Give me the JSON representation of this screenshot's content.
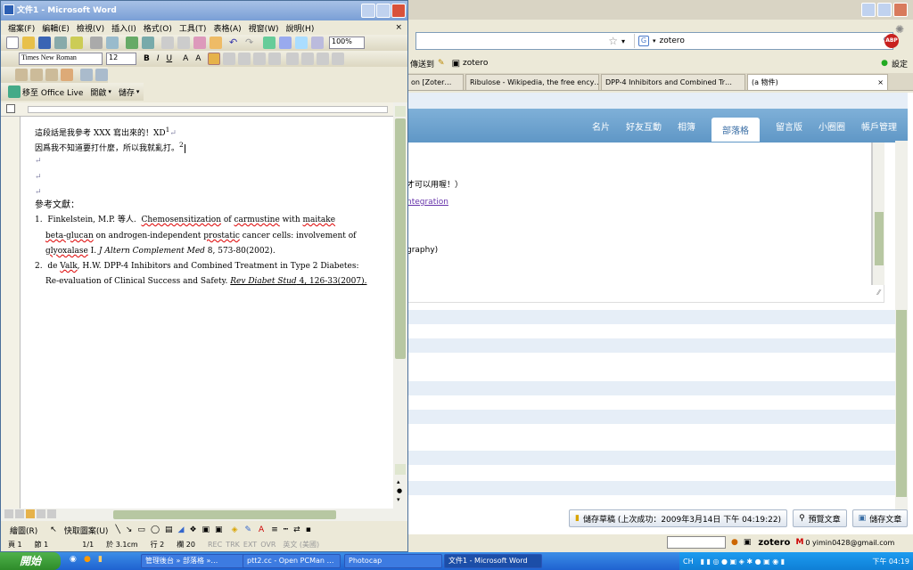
{
  "word": {
    "title": "文件1 - Microsoft Word",
    "menu": [
      "檔案(F)",
      "編輯(E)",
      "檢視(V)",
      "插入(I)",
      "格式(O)",
      "工具(T)",
      "表格(A)",
      "視窗(W)",
      "說明(H)"
    ],
    "zoom": "100%",
    "font": "Times New Roman",
    "size": "12",
    "office_live": "移至 Office Live",
    "open": "開啟",
    "save": "儲存",
    "doc": {
      "line1": "這段話是我參考 XXX 寫出來的！XD",
      "line1_sup": "1",
      "line2": "因爲我不知道要打什麼，所以我就亂打。",
      "line2_sup": "2",
      "refs_heading": "參考文獻：",
      "ref1_num": "1.",
      "ref1_a": "Finkelstein, M.P.  等人.",
      "ref1_b": "Chemosensitization",
      "ref1_c": " of ",
      "ref1_d": "carmustine",
      "ref1_e": " with ",
      "ref1_f": "maitake",
      "ref1_g": "beta-glucan",
      "ref1_h": " on androgen-independent ",
      "ref1_i": "prostatic",
      "ref1_j": " cancer cells: involvement of",
      "ref1_k": "glyoxalase",
      "ref1_l": " I. ",
      "ref1_m": "J Altern Complement Med",
      "ref1_n": " 8, 573-80(2002).",
      "ref2_num": "2.",
      "ref2_a": "de ",
      "ref2_b": "Valk",
      "ref2_c": ", H.W. DPP-4 Inhibitors and Combined Treatment in Type 2 Diabetes:",
      "ref2_d": "Re-evaluation of Clinical Success and Safety. ",
      "ref2_e": "Rev Diabet Stud",
      "ref2_f": " 4, 126-33(2007)."
    },
    "draw_label": "繪圖(R)",
    "autoshape": "快取圖案(U)",
    "status": [
      "頁 1",
      "節 1",
      "1/1",
      "於 3.1cm",
      "行 2",
      "欄 20",
      "REC",
      "TRK",
      "EXT",
      "OVR",
      "英文 (美國)"
    ]
  },
  "firefox": {
    "url_search": "zotero",
    "bm_send": "傳送到",
    "bm_zotero": "zotero",
    "settings": "設定",
    "tabs": [
      "on [Zoter…",
      "Ribulose - Wikipedia, the free ency…",
      "DPP-4 Inhibitors and Combined Tr…",
      "(a 物件)"
    ],
    "nav": [
      "名片",
      "好友互動",
      "相簿",
      "部落格",
      "留言版",
      "小圈圈",
      "帳戶管理"
    ],
    "editor_text1": "才可以用喔！）",
    "editor_link": "ntegration",
    "editor_text2": "graphy)",
    "draft": "儲存草稿 (上次成功：2009年3月14日 下午 04:19:22)",
    "preview": "預覽文章",
    "publish": "儲存文章",
    "status_zotero": "zotero",
    "status_mail": "0 yimin0428@gmail.com"
  },
  "taskbar": {
    "start": "開始",
    "tasks": [
      "管理後台 » 部落格 »…",
      "ptt2.cc - Open PCMan …",
      "Photocap",
      "文件1 - Microsoft Word"
    ],
    "tray_lang": "CH",
    "clock": "下午 04:19"
  }
}
